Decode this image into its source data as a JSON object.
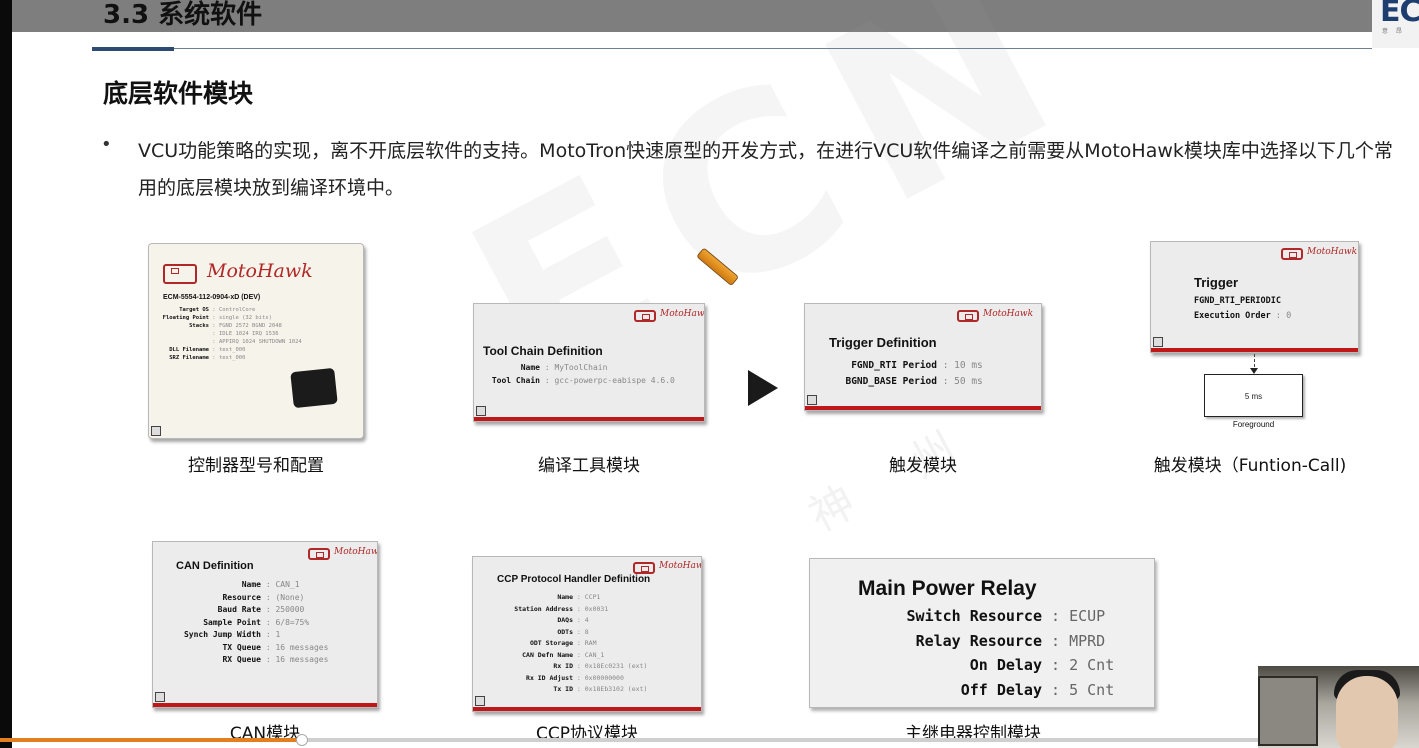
{
  "header": {
    "slide_title": "3.3 系统软件",
    "logo_text": "EC",
    "logo_sub": "意 昂"
  },
  "section": {
    "title": "底层软件模块",
    "bullet_text": "VCU功能策略的实现，离不开底层软件的支持。MotoTron快速原型的开发方式，在进行VCU软件编译之前需要从MotoHawk模块库中选择以下几个常用的底层模块放到编译环境中。"
  },
  "watermark": {
    "main": "ECN",
    "sub": "神 州"
  },
  "blocks": {
    "controller": {
      "logo": "MotoHawk",
      "model": "ECM-5554-112-0904-xD (DEV)",
      "rows": [
        {
          "k": "Target OS",
          "v": "ControlCore"
        },
        {
          "k": "Floating Point",
          "v": "single (32 bits)"
        },
        {
          "k": "Stacks",
          "v": "FGND 2572 BGND 2048"
        },
        {
          "k": "",
          "v": "IDLE 1024 IRQ 1536"
        },
        {
          "k": "",
          "v": "APPIRQ 1024 SHUTDOWN 1024"
        },
        {
          "k": "DLL Filename",
          "v": "test_000"
        },
        {
          "k": "SRZ Filename",
          "v": "test_000"
        }
      ],
      "caption": "控制器型号和配置"
    },
    "toolchain": {
      "logo": "MotoHawk",
      "title": "Tool Chain Definition",
      "rows": [
        {
          "k": "Name",
          "v": "MyToolChain"
        },
        {
          "k": "Tool Chain",
          "v": "gcc-powerpc-eabispe 4.6.0"
        }
      ],
      "caption": "编译工具模块"
    },
    "trigger_def": {
      "logo": "MotoHawk",
      "title": "Trigger Definition",
      "rows": [
        {
          "k": "FGND_RTI Period",
          "v": "10 ms"
        },
        {
          "k": "BGND_BASE Period",
          "v": "50 ms"
        }
      ],
      "caption": "触发模块"
    },
    "trigger_call": {
      "logo": "MotoHawk",
      "title": "Trigger",
      "rows": [
        {
          "k": "FGND_RTI_PERIODIC",
          "v": ""
        },
        {
          "k": "Execution Order",
          "v": "0"
        }
      ],
      "sub_block_text": "5 ms",
      "sub_block_label": "Foreground",
      "caption": "触发模块（Funtion-Call)"
    },
    "can_def": {
      "logo": "MotoHawk",
      "title": "CAN Definition",
      "rows": [
        {
          "k": "Name",
          "v": "CAN_1"
        },
        {
          "k": "Resource",
          "v": "(None)"
        },
        {
          "k": "Baud Rate",
          "v": "250000"
        },
        {
          "k": "Sample Point",
          "v": "6/8=75%"
        },
        {
          "k": "Synch Jump Width",
          "v": "1"
        },
        {
          "k": "TX Queue",
          "v": "16 messages"
        },
        {
          "k": "RX Queue",
          "v": "16 messages"
        }
      ],
      "caption": "CAN模块"
    },
    "ccp_def": {
      "logo": "MotoHawk",
      "title": "CCP Protocol Handler Definition",
      "rows": [
        {
          "k": "Name",
          "v": "CCP1"
        },
        {
          "k": "Station Address",
          "v": "0x0031"
        },
        {
          "k": "DAQs",
          "v": "4"
        },
        {
          "k": "ODTs",
          "v": "8"
        },
        {
          "k": "ODT Storage",
          "v": "RAM"
        },
        {
          "k": "CAN Defn Name",
          "v": "CAN_1"
        },
        {
          "k": "Rx ID",
          "v": "0x18Ec0231 (ext)"
        },
        {
          "k": "Rx ID Adjust",
          "v": "0x00000000"
        },
        {
          "k": "Tx ID",
          "v": "0x18Eb3102 (ext)"
        }
      ],
      "caption": "CCP协议模块"
    },
    "relay": {
      "title": "Main Power Relay",
      "rows": [
        {
          "k": "Switch Resource",
          "v": "ECUP"
        },
        {
          "k": "Relay Resource",
          "v": "MPRD"
        },
        {
          "k": "On Delay",
          "v": "2 Cnt"
        },
        {
          "k": "Off Delay",
          "v": "5 Cnt"
        }
      ],
      "caption": "主继电器控制模块"
    }
  },
  "icons": {
    "play": "play-icon",
    "pencil": "pencil-icon",
    "block_corner": "block-corner-icon"
  },
  "colors": {
    "top_bar": "#7e7e7e",
    "accent_rule": "#2d4a72",
    "block_red": "#c01818",
    "block_green": "#1f8f2e",
    "progress": "#e2801f"
  },
  "video": {
    "progress_fraction": 0.24
  }
}
